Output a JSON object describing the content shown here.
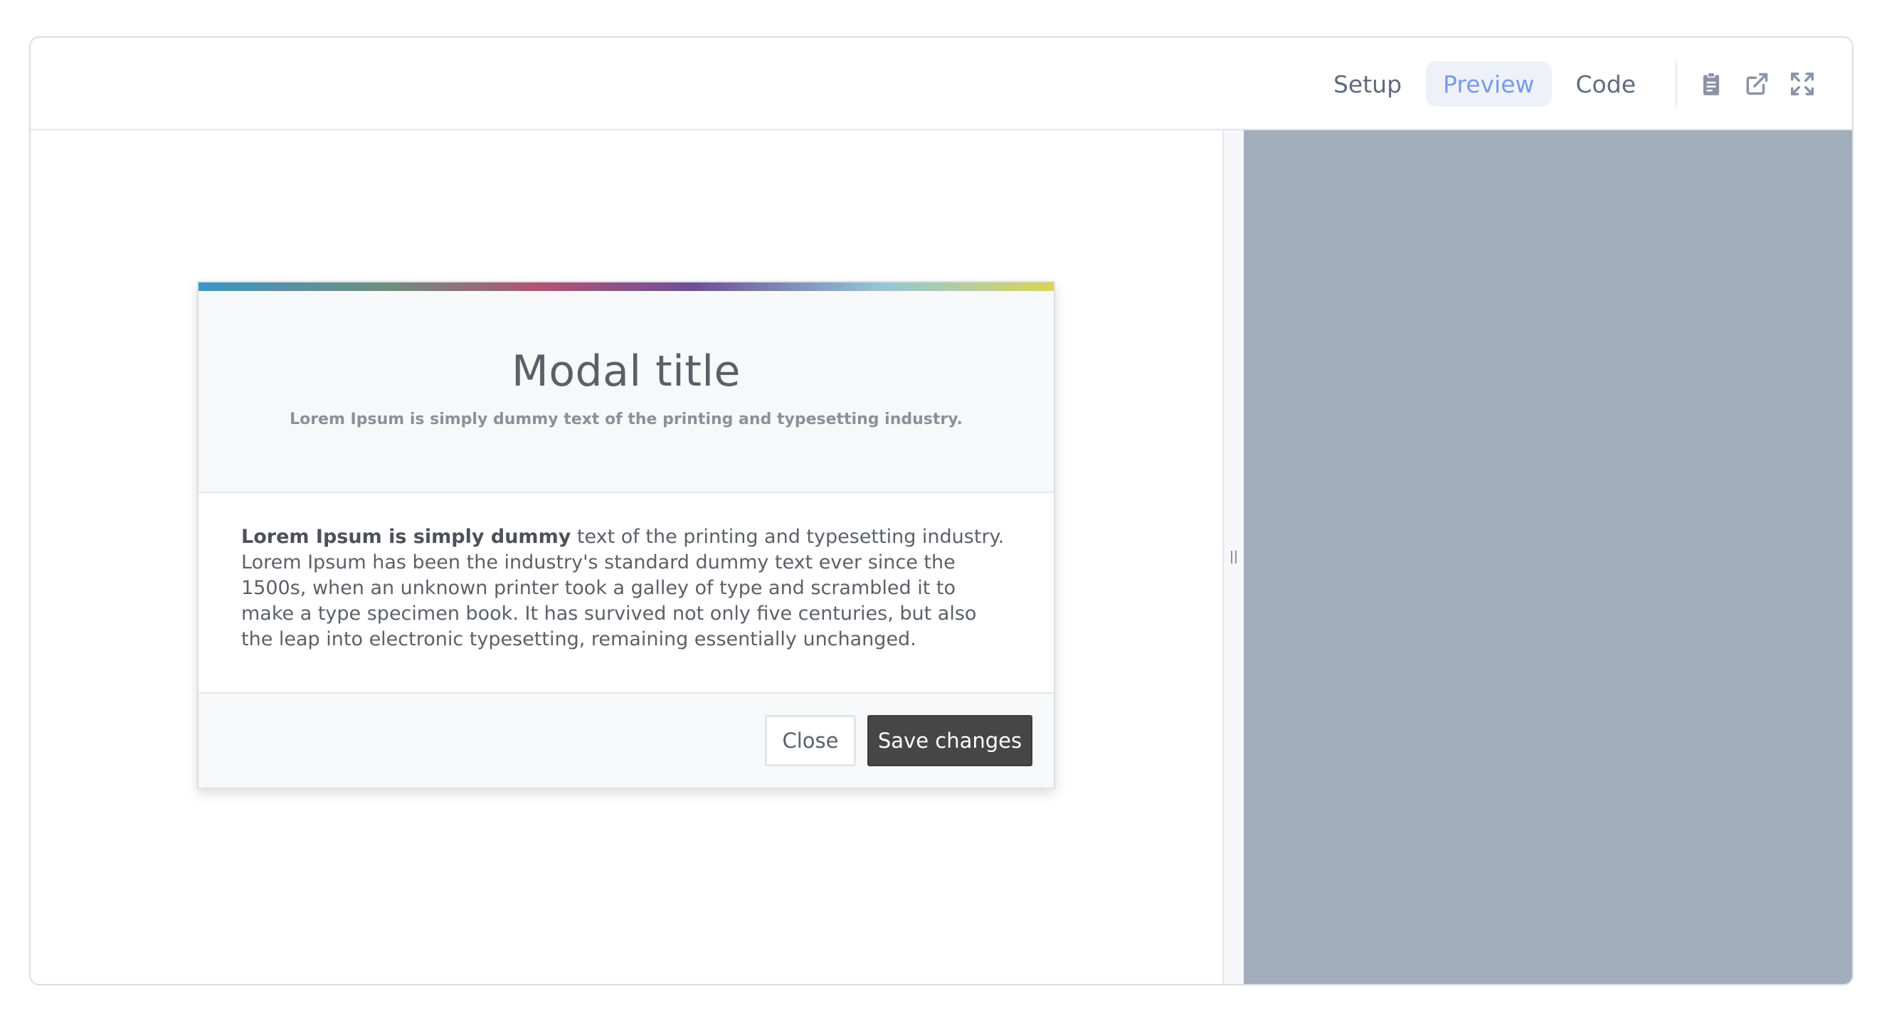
{
  "toolbar": {
    "tabs": [
      {
        "label": "Setup",
        "active": false
      },
      {
        "label": "Preview",
        "active": true
      },
      {
        "label": "Code",
        "active": false
      }
    ],
    "icons": [
      "clipboard-icon",
      "external-link-icon",
      "fullscreen-icon"
    ]
  },
  "modal": {
    "title": "Modal title",
    "subtitle": "Lorem Ipsum is simply dummy text of the printing and typesetting industry.",
    "body_bold": "Lorem Ipsum is simply dummy",
    "body_rest": " text of the printing and typesetting industry. Lorem Ipsum has been the industry's standard dummy text ever since the 1500s, when an unknown printer took a galley of type and scrambled it to make a type specimen book. It has survived not only five centuries, but also the leap into electronic typesetting, remaining essentially unchanged.",
    "close_label": "Close",
    "save_label": "Save changes"
  },
  "colors": {
    "accent_active_tab": "#7a9ae8",
    "gray_pane": "#a3aebd",
    "save_button": "#464646"
  }
}
